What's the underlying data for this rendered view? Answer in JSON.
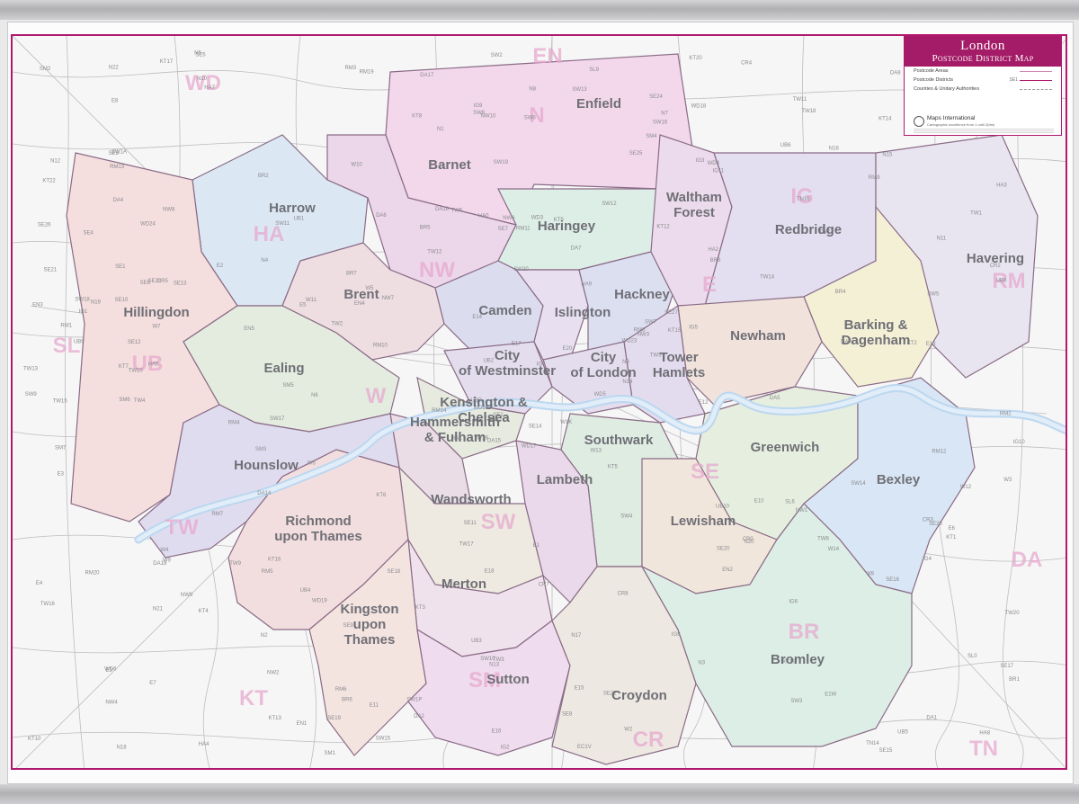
{
  "legend": {
    "title": "London",
    "subtitle": "Postcode District Map",
    "keys": [
      {
        "label": "Postcode Areas",
        "code": ""
      },
      {
        "label": "Postcode Districts",
        "code": "SE1"
      },
      {
        "label": "Counties & Unitary Authorities",
        "code": ""
      }
    ],
    "publisher": "Maps International",
    "publisher_tag": "Cartographic excellence from 1 until 2(ttm)",
    "colors": {
      "accent": "#a41b67",
      "border": "#b0186e"
    }
  },
  "boroughs": [
    {
      "name": "Enfield",
      "color": "#f3d8ec"
    },
    {
      "name": "Barnet",
      "color": "#ecd6ea"
    },
    {
      "name": "Harrow",
      "color": "#dbe8f4"
    },
    {
      "name": "Hillingdon",
      "color": "#f4dede"
    },
    {
      "name": "Brent",
      "color": "#eedee2"
    },
    {
      "name": "Ealing",
      "color": "#e4ecdf"
    },
    {
      "name": "Haringey",
      "color": "#ddeee6"
    },
    {
      "name": "Camden",
      "color": "#dcdcef"
    },
    {
      "name": "Islington",
      "color": "#e8e0f0"
    },
    {
      "name": "Hackney",
      "color": "#dcdff0"
    },
    {
      "name": "Waltham Forest",
      "color": "#ecdbec"
    },
    {
      "name": "Redbridge",
      "color": "#e3dff0"
    },
    {
      "name": "Havering",
      "color": "#e8e4f0"
    },
    {
      "name": "Barking & Dagenham",
      "color": "#f3f0d6"
    },
    {
      "name": "Newham",
      "color": "#f1e3dc"
    },
    {
      "name": "Tower Hamlets",
      "color": "#e3dcee"
    },
    {
      "name": "City of Westminster",
      "color": "#e4ddee"
    },
    {
      "name": "City of London",
      "color": "#e4ddee"
    },
    {
      "name": "Kensington & Chelsea",
      "color": "#e6eadf"
    },
    {
      "name": "Hammersmith & Fulham",
      "color": "#eadde6"
    },
    {
      "name": "Southwark",
      "color": "#dfece2"
    },
    {
      "name": "Lambeth",
      "color": "#ead9ea"
    },
    {
      "name": "Greenwich",
      "color": "#e6efdf"
    },
    {
      "name": "Bexley",
      "color": "#d9e6f5"
    },
    {
      "name": "Lewisham",
      "color": "#f1e6dc"
    },
    {
      "name": "Hounslow",
      "color": "#e0dcef"
    },
    {
      "name": "Richmond upon Thames",
      "color": "#f3dedf"
    },
    {
      "name": "Wandsworth",
      "color": "#eeeae1"
    },
    {
      "name": "Merton",
      "color": "#f0e2ec"
    },
    {
      "name": "Kingston upon Thames",
      "color": "#f4e4e0"
    },
    {
      "name": "Sutton",
      "color": "#efdcee"
    },
    {
      "name": "Croydon",
      "color": "#ede8e1"
    },
    {
      "name": "Bromley",
      "color": "#dceee6"
    }
  ],
  "areas": [
    "EN",
    "WD",
    "HA",
    "NW",
    "UB",
    "SL",
    "IG",
    "RM",
    "DA",
    "TW",
    "KT",
    "CR",
    "SE",
    "BR",
    "TN",
    "W",
    "E",
    "N",
    "SW",
    "SM"
  ],
  "districts": [
    "WD17",
    "WD24",
    "WD25",
    "WD6",
    "WD23",
    "WD19",
    "WD18",
    "WD3",
    "WD4",
    "WD5",
    "HA7",
    "HA8",
    "HA5",
    "HA3",
    "HA1",
    "HA2",
    "HA4",
    "HA0",
    "HA9",
    "NW9",
    "NW7",
    "NW4",
    "NW2",
    "NW6",
    "NW3",
    "NW1",
    "NW8",
    "NW10",
    "UB9",
    "UB10",
    "UB8",
    "UB7",
    "UB3",
    "UB2",
    "UB1",
    "UB6",
    "UB4",
    "UB5",
    "SL0",
    "SL6",
    "SL9",
    "EN4",
    "EN5",
    "EN2",
    "EN1",
    "EN3",
    "N9",
    "N18",
    "N13",
    "N14",
    "N21",
    "N11",
    "N12",
    "N20",
    "N3",
    "N2",
    "N10",
    "N22",
    "N17",
    "N15",
    "N8",
    "N6",
    "N19",
    "N4",
    "N16",
    "N5",
    "N7",
    "N1",
    "E17",
    "E4",
    "E18",
    "E11",
    "E10",
    "E5",
    "E9",
    "E8",
    "E2",
    "E3",
    "E14",
    "E15",
    "E20",
    "E7",
    "E12",
    "E6",
    "E16",
    "E13",
    "E1",
    "E1W",
    "EC1V",
    "IG8",
    "IG9",
    "IG10",
    "IG5",
    "IG6",
    "IG7",
    "IG4",
    "IG1",
    "IG2",
    "IG3",
    "IG11",
    "RM4",
    "RM3",
    "RM2",
    "RM1",
    "RM7",
    "RM5",
    "RM6",
    "RM8",
    "RM9",
    "RM10",
    "RM12",
    "RM13",
    "RM11",
    "RM14",
    "RM19",
    "RM20",
    "DA15",
    "DA16",
    "DA17",
    "DA18",
    "DA8",
    "DA7",
    "DA6",
    "DA5",
    "DA14",
    "DA1",
    "DA2",
    "DA9",
    "DA4",
    "W9",
    "W2",
    "W11",
    "W10",
    "W12",
    "W14",
    "W6",
    "W4",
    "W3",
    "W5",
    "W13",
    "W7",
    "W8",
    "W1K",
    "SW7",
    "SW1A",
    "SW1P",
    "SW3",
    "SW10",
    "SW6",
    "SW5",
    "SW11",
    "SW18",
    "SW15",
    "SW14",
    "SW13",
    "SW19",
    "SW20",
    "SW17",
    "SW12",
    "SW4",
    "SW8",
    "SW9",
    "SW2",
    "SW16",
    "SE1",
    "SE11",
    "SE17",
    "SE5",
    "SE15",
    "SE16",
    "SE22",
    "SE21",
    "SE24",
    "SE27",
    "SE19",
    "SE25",
    "SE20",
    "SE26",
    "SE23",
    "SE4",
    "SE14",
    "SE8",
    "SE10",
    "SE3",
    "SE13",
    "SE6",
    "SE12",
    "SE9",
    "SE2",
    "SE28",
    "SE18",
    "SE7",
    "TW7",
    "TW5",
    "TW3",
    "TW4",
    "TW6",
    "TW8",
    "TW9",
    "TW10",
    "TW11",
    "TW12",
    "TW13",
    "TW14",
    "TW15",
    "TW19",
    "TW16",
    "TW17",
    "TW18",
    "TW20",
    "TW1",
    "TW2",
    "KT1",
    "KT2",
    "KT3",
    "KT4",
    "KT5",
    "KT6",
    "KT7",
    "KT8",
    "KT9",
    "KT10",
    "KT12",
    "KT13",
    "KT16",
    "KT15",
    "KT14",
    "KT17",
    "KT19",
    "KT20",
    "KT22",
    "SM1",
    "SM2",
    "SM3",
    "SM4",
    "SM5",
    "SM6",
    "SM7",
    "CR0",
    "CR2",
    "CR3",
    "CR4",
    "CR5",
    "CR7",
    "CR8",
    "BR1",
    "BR2",
    "BR3",
    "BR4",
    "BR5",
    "BR6",
    "BR7",
    "TN14",
    "TN16"
  ]
}
